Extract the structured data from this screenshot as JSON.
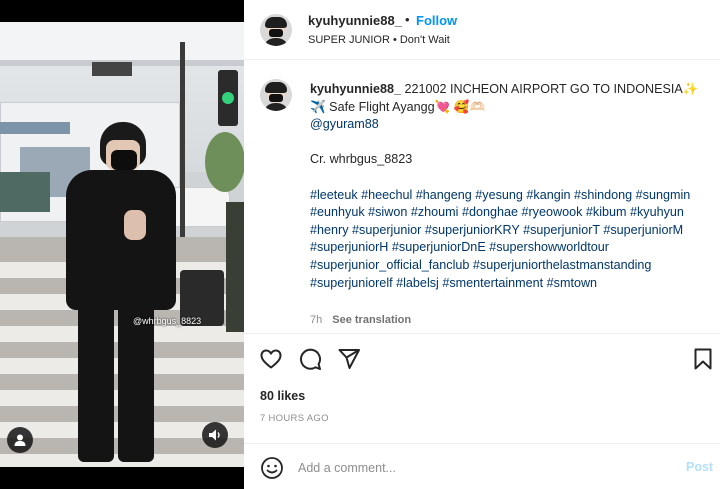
{
  "post": {
    "username": "kyuhyunnie88_",
    "separator": "•",
    "follow_label": "Follow",
    "audio": "SUPER JUNIOR • Don't Wait"
  },
  "caption": {
    "username": "kyuhyunnie88_",
    "line1": " 221002 INCHEON AIRPORT GO TO INDONESIA✨ ✈️ Safe Flight Ayangg💘 🥰🫶🏻",
    "mention": "@gyuram88",
    "credit": "Cr. whrbgus_8823",
    "hashtags": [
      "#leeteuk",
      "#heechul",
      "#hangeng",
      "#yesung",
      "#kangin",
      "#shindong",
      "#sungmin",
      "#eunhyuk",
      "#siwon",
      "#zhoumi",
      "#donghae",
      "#ryeowook",
      "#kibum",
      "#kyuhyun",
      "#henry",
      "#superjunior",
      "#superjuniorKRY",
      "#superjuniorT",
      "#superjuniorM",
      "#superjuniorH",
      "#superjuniorDnE",
      "#supershowworldtour",
      "#superjunior_official_fanclub",
      "#superjuniorthelastmanstanding",
      "#superjuniorelf",
      "#labelsj",
      "#smentertainment",
      "#smtown"
    ],
    "age": "7h",
    "see_translation": "See translation"
  },
  "media": {
    "watermark": "@whrbgus_8823"
  },
  "stats": {
    "likes": "80 likes",
    "time": "7 HOURS AGO"
  },
  "comment": {
    "placeholder": "Add a comment...",
    "post_label": "Post"
  },
  "icons": {
    "like": "heart-icon",
    "comment": "comment-icon",
    "share": "paper-plane-icon",
    "save": "bookmark-icon",
    "emoji": "smiley-icon",
    "user": "user-icon",
    "sound": "speaker-icon"
  },
  "colors": {
    "follow": "#0095f6",
    "hashtag": "#00376b",
    "post_disabled": "#b2dffc",
    "muted": "#8e8e8e"
  }
}
